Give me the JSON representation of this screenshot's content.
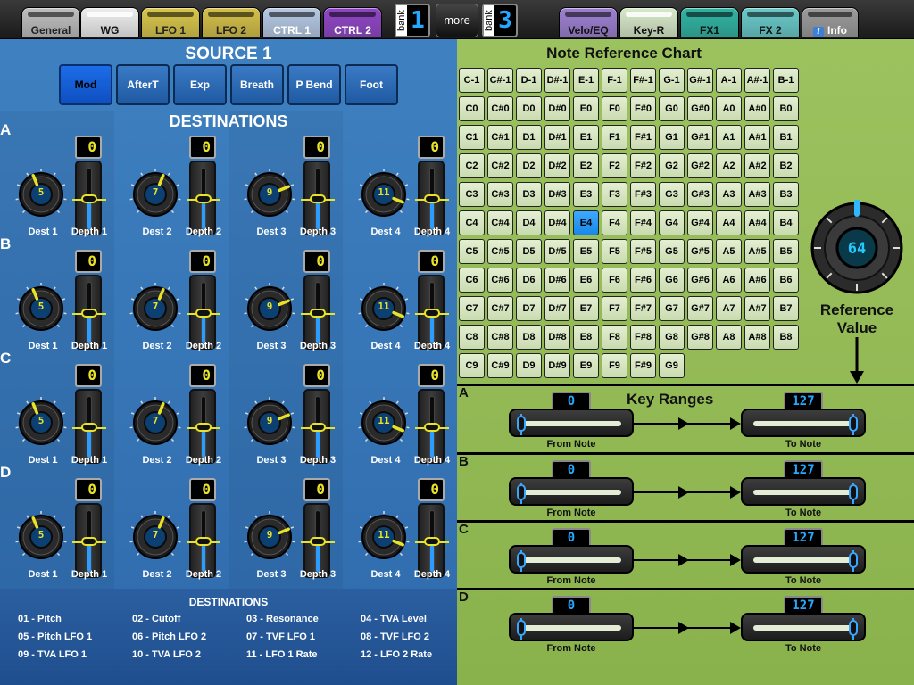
{
  "tabs_left": [
    {
      "label": "General",
      "bg": "#bdbdbd",
      "fg": "#222"
    },
    {
      "label": "WG",
      "bg": "#ededed",
      "fg": "#111",
      "selected": true
    },
    {
      "label": "LFO 1",
      "bg": "#d8c54a",
      "fg": "#222"
    },
    {
      "label": "LFO 2",
      "bg": "#d3bf47",
      "fg": "#222"
    },
    {
      "label": "CTRL 1",
      "bg": "#b5c9e4",
      "fg": "#fff"
    },
    {
      "label": "CTRL 2",
      "bg": "#8f45c4",
      "fg": "#fff"
    }
  ],
  "bank1": {
    "label": "bank",
    "value": "1"
  },
  "more_label": "more",
  "bank2": {
    "label": "bank",
    "value": "3"
  },
  "tabs_right": [
    {
      "label": "Velo/EQ",
      "bg": "#9c7fd0",
      "fg": "#111"
    },
    {
      "label": "Key-R",
      "bg": "#d7e8c8",
      "fg": "#111",
      "selected": true
    },
    {
      "label": "FX1",
      "bg": "#2fb3a2",
      "fg": "#111"
    },
    {
      "label": "FX 2",
      "bg": "#68c9c9",
      "fg": "#111"
    },
    {
      "label": "Info",
      "bg": "#9a9a9a",
      "fg": "#fff",
      "icon": "info-icon"
    }
  ],
  "source": {
    "title": "SOURCE 1",
    "buttons": [
      {
        "label": "Mod",
        "active": true
      },
      {
        "label": "AfterT"
      },
      {
        "label": "Exp"
      },
      {
        "label": "Breath"
      },
      {
        "label": "P Bend"
      },
      {
        "label": "Foot"
      }
    ]
  },
  "destinations": {
    "title": "DESTINATIONS",
    "rows": [
      {
        "label": "A",
        "dests": [
          {
            "knob": "5",
            "depth": "0",
            "dest_label": "Dest 1",
            "depth_label": "Depth 1"
          },
          {
            "knob": "7",
            "depth": "0",
            "dest_label": "Dest 2",
            "depth_label": "Depth 2"
          },
          {
            "knob": "9",
            "depth": "0",
            "dest_label": "Dest 3",
            "depth_label": "Depth 3"
          },
          {
            "knob": "11",
            "depth": "0",
            "dest_label": "Dest 4",
            "depth_label": "Depth 4"
          }
        ]
      },
      {
        "label": "B",
        "dests": [
          {
            "knob": "5",
            "depth": "0",
            "dest_label": "Dest 1",
            "depth_label": "Depth 1"
          },
          {
            "knob": "7",
            "depth": "0",
            "dest_label": "Dest 2",
            "depth_label": "Depth 2"
          },
          {
            "knob": "9",
            "depth": "0",
            "dest_label": "Dest 3",
            "depth_label": "Depth 3"
          },
          {
            "knob": "11",
            "depth": "0",
            "dest_label": "Dest 4",
            "depth_label": "Depth 4"
          }
        ]
      },
      {
        "label": "C",
        "dests": [
          {
            "knob": "5",
            "depth": "0",
            "dest_label": "Dest 1",
            "depth_label": "Depth 1"
          },
          {
            "knob": "7",
            "depth": "0",
            "dest_label": "Dest 2",
            "depth_label": "Depth 2"
          },
          {
            "knob": "9",
            "depth": "0",
            "dest_label": "Dest 3",
            "depth_label": "Depth 3"
          },
          {
            "knob": "11",
            "depth": "0",
            "dest_label": "Dest 4",
            "depth_label": "Depth 4"
          }
        ]
      },
      {
        "label": "D",
        "dests": [
          {
            "knob": "5",
            "depth": "0",
            "dest_label": "Dest 1",
            "depth_label": "Depth 1"
          },
          {
            "knob": "7",
            "depth": "0",
            "dest_label": "Dest 2",
            "depth_label": "Depth 2"
          },
          {
            "knob": "9",
            "depth": "0",
            "dest_label": "Dest 3",
            "depth_label": "Depth 3"
          },
          {
            "knob": "11",
            "depth": "0",
            "dest_label": "Dest 4",
            "depth_label": "Depth 4"
          }
        ]
      }
    ],
    "list_title": "DESTINATIONS",
    "list": [
      "01 - Pitch",
      "02 - Cutoff",
      "03 - Resonance",
      "04 - TVA Level",
      "05 - Pitch LFO 1",
      "06 - Pitch LFO 2",
      "07 - TVF LFO 1",
      "08 - TVF LFO 2",
      "09 - TVA LFO 1",
      "10 - TVA LFO 2",
      "11 - LFO 1 Rate",
      "12 - LFO 2 Rate"
    ]
  },
  "note_chart": {
    "title": "Note Reference Chart",
    "highlight": "E4",
    "rows": [
      [
        "C-1",
        "C#-1",
        "D-1",
        "D#-1",
        "E-1",
        "F-1",
        "F#-1",
        "G-1",
        "G#-1",
        "A-1",
        "A#-1",
        "B-1"
      ],
      [
        "C0",
        "C#0",
        "D0",
        "D#0",
        "E0",
        "F0",
        "F#0",
        "G0",
        "G#0",
        "A0",
        "A#0",
        "B0"
      ],
      [
        "C1",
        "C#1",
        "D1",
        "D#1",
        "E1",
        "F1",
        "F#1",
        "G1",
        "G#1",
        "A1",
        "A#1",
        "B1"
      ],
      [
        "C2",
        "C#2",
        "D2",
        "D#2",
        "E2",
        "F2",
        "F#2",
        "G2",
        "G#2",
        "A2",
        "A#2",
        "B2"
      ],
      [
        "C3",
        "C#3",
        "D3",
        "D#3",
        "E3",
        "F3",
        "F#3",
        "G3",
        "G#3",
        "A3",
        "A#3",
        "B3"
      ],
      [
        "C4",
        "C#4",
        "D4",
        "D#4",
        "E4",
        "F4",
        "F#4",
        "G4",
        "G#4",
        "A4",
        "A#4",
        "B4"
      ],
      [
        "C5",
        "C#5",
        "D5",
        "D#5",
        "E5",
        "F5",
        "F#5",
        "G5",
        "G#5",
        "A5",
        "A#5",
        "B5"
      ],
      [
        "C6",
        "C#6",
        "D6",
        "D#6",
        "E6",
        "F6",
        "F#6",
        "G6",
        "G#6",
        "A6",
        "A#6",
        "B6"
      ],
      [
        "C7",
        "C#7",
        "D7",
        "D#7",
        "E7",
        "F7",
        "F#7",
        "G7",
        "G#7",
        "A7",
        "A#7",
        "B7"
      ],
      [
        "C8",
        "C#8",
        "D8",
        "D#8",
        "E8",
        "F8",
        "F#8",
        "G8",
        "G#8",
        "A8",
        "A#8",
        "B8"
      ],
      [
        "C9",
        "C#9",
        "D9",
        "D#9",
        "E9",
        "F9",
        "F#9",
        "G9"
      ]
    ]
  },
  "reference": {
    "value": "64",
    "label": "Reference Value",
    "fraction": 0.5
  },
  "key_ranges": {
    "title": "Key Ranges",
    "rows": [
      {
        "label": "A",
        "from": "0",
        "to": "127",
        "from_label": "From Note",
        "to_label": "To Note"
      },
      {
        "label": "B",
        "from": "0",
        "to": "127",
        "from_label": "From Note",
        "to_label": "To Note"
      },
      {
        "label": "C",
        "from": "0",
        "to": "127",
        "from_label": "From Note",
        "to_label": "To Note"
      },
      {
        "label": "D",
        "from": "0",
        "to": "127",
        "from_label": "From Note",
        "to_label": "To Note"
      }
    ]
  },
  "colors": {
    "knob_pointer": "#e8e22a",
    "accent_blue": "#2d9cff"
  }
}
